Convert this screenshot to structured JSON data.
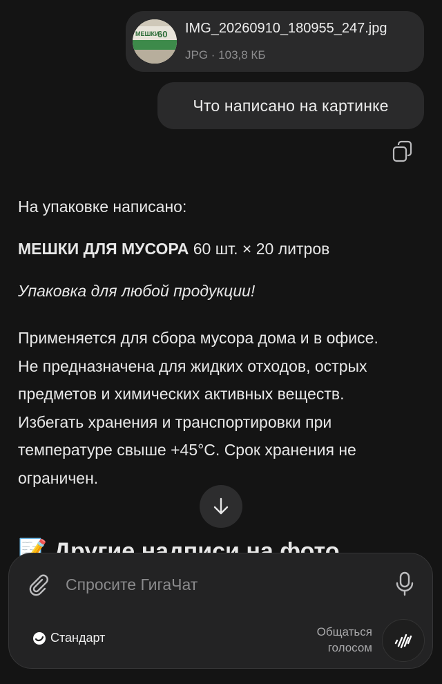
{
  "attachment": {
    "file_name": "IMG_20260910_180955_247.jpg",
    "file_meta": "JPG · 103,8 КБ",
    "thumbnail_text_1": "МЕШКИ",
    "thumbnail_text_2": "60"
  },
  "user_message": "Что написано на картинке",
  "answer": {
    "intro": "На упаковке написано:",
    "heading_bold": "МЕШКИ ДЛЯ МУСОРА",
    "heading_rest": " 60 шт. × 20 литров",
    "italic": "Упаковка для любой продукции!",
    "body_lines": [
      "Применяется для сбора мусора дома и в офисе.",
      "Не предназначена для жидких отходов, острых",
      "предметов и химических активных веществ.",
      "Избегать хранения и транспортировки при",
      "температуре свыше +45°C. Срок хранения не",
      "ограничен."
    ],
    "next_heading": "📝 Другие надписи на фото"
  },
  "composer": {
    "placeholder": "Спросите ГигаЧат",
    "mode_label": "Стандарт",
    "voice_label_line1": "Общаться",
    "voice_label_line2": "голосом"
  },
  "icons": {
    "copy": "copy-icon",
    "scroll": "arrow-down-icon",
    "attach": "paperclip-icon",
    "mic": "microphone-icon",
    "mode": "sber-logo-icon",
    "voice": "voice-wave-icon"
  }
}
